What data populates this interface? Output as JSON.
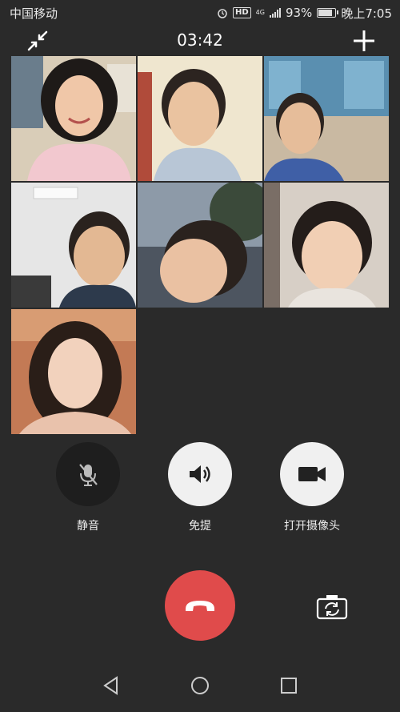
{
  "status_bar": {
    "carrier": "中国移动",
    "hd": "HD",
    "network": "4G",
    "battery_percent": "93%",
    "battery_level": 0.93,
    "time": "晚上7:05"
  },
  "call": {
    "timer": "03:42"
  },
  "participants": [
    {
      "id": "participant-1"
    },
    {
      "id": "participant-2"
    },
    {
      "id": "participant-3"
    },
    {
      "id": "participant-4"
    },
    {
      "id": "participant-5"
    },
    {
      "id": "participant-6"
    },
    {
      "id": "participant-7"
    }
  ],
  "controls": {
    "mute_label": "静音",
    "speaker_label": "免提",
    "camera_label": "打开摄像头"
  },
  "icons": {
    "minimize": "minimize-icon",
    "add": "add-participant-icon",
    "mute": "mic-off-icon",
    "speaker": "speaker-icon",
    "camera": "video-camera-icon",
    "hangup": "hang-up-icon",
    "switch_camera": "switch-camera-icon",
    "back": "back-triangle-icon",
    "home": "home-circle-icon",
    "recents": "recents-square-icon"
  },
  "colors": {
    "background": "#2a2a2a",
    "hangup": "#e04b4b",
    "mute_bg": "#1e1e1e",
    "button_bg": "#f0f0f0"
  }
}
